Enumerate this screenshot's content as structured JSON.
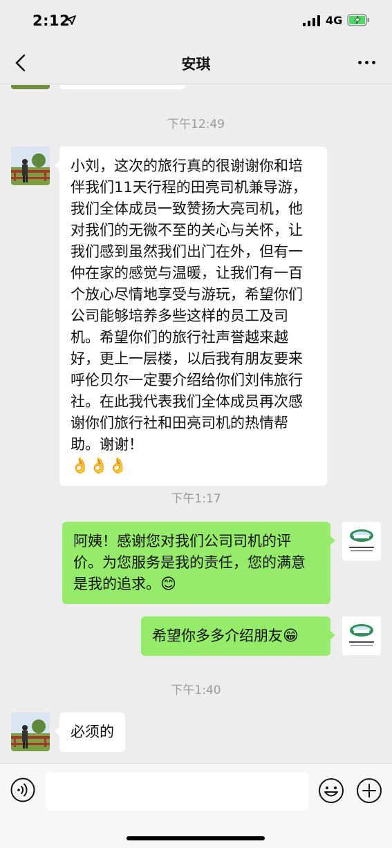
{
  "status": {
    "time": "2:12",
    "network": "4G"
  },
  "header": {
    "title": "安琪"
  },
  "messages": [
    {
      "type": "timestamp",
      "text": "下午12:49"
    },
    {
      "type": "incoming",
      "text": "小刘，这次的旅行真的很谢谢你和培伴我们11天行程的田亮司机兼导游，我们全体成员一致赞扬大亮司机，他对我们的无微不至的关心与关怀，让我们感到虽然我们出门在外，但有一仲在家的感觉与温暖，让我们有一百个放心尽情地享受与游玩，希望你们公司能够培养多些这样的员工及司机。希望你们的旅行社声誉越来越好，更上一层楼，以后我有朋友要来呼伦贝尔一定要介绍给你们刘伟旅行社。在此我代表我们全体成员再次感谢你们旅行社和田亮司机的热情帮助。谢谢！",
      "emoji": "👌👌👌"
    },
    {
      "type": "timestamp",
      "text": "下午1:17"
    },
    {
      "type": "outgoing",
      "text": "阿姨！感谢您对我们公司司机的评价。为您服务是我的责任，您的满意是我的追求。",
      "emoji": "😊"
    },
    {
      "type": "outgoing",
      "text": "希望你多多介绍朋友",
      "emoji": "😁"
    },
    {
      "type": "timestamp",
      "text": "下午1:40"
    },
    {
      "type": "incoming",
      "text": "必须的"
    }
  ],
  "input": {
    "placeholder": ""
  },
  "icons": {
    "back": "chevron-left-icon",
    "more": "more-icon",
    "voice": "voice-icon",
    "emoji": "emoji-icon",
    "plus": "plus-icon"
  },
  "colors": {
    "background": "#ededed",
    "outgoing_bubble": "#95ec69",
    "incoming_bubble": "#ffffff",
    "timestamp": "#9b9b9b"
  }
}
